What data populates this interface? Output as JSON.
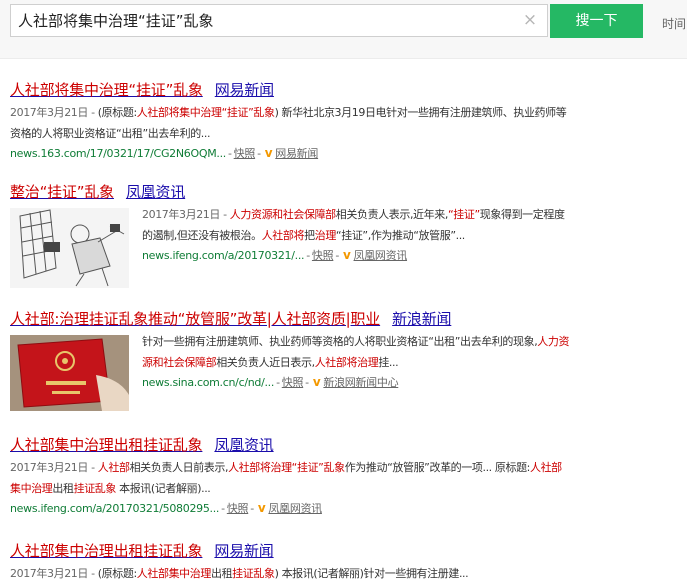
{
  "search": {
    "query": "人社部将集中治理“挂证”乱象",
    "clear_icon": "×",
    "button_label": "搜一下",
    "time_filter": "时间"
  },
  "results": [
    {
      "title": [
        "人社部将集中治理“挂证”乱象",
        "网易新闻"
      ],
      "snippet": {
        "date": "2017年3月21日 - ",
        "pre": "(原标题:",
        "hl": "人社部将集中治理“挂证”乱象",
        "post": ") 新华社北京3月19日电针对一些拥有注册建筑师、执业药师等资格的人将职业资格证“出租”出去牟利的..."
      },
      "url": "news.163.com/17/0321/17/CG2N6OQM...",
      "snapshot": "快照",
      "source": "网易新闻"
    },
    {
      "title": [
        "整治“挂证”乱象",
        "凤凰资讯"
      ],
      "snippet": {
        "date": "2017年3月21日 - ",
        "hl1": "人力资源和社会保障部",
        "mid1": "相关负责人表示,近年来,",
        "hl2": "“挂证”",
        "mid2": "现象得到一定程度的遏制,但还没有被根治。",
        "hl3": "人社部将",
        "mid3": "把",
        "hl4": "治理",
        "post": "“挂证”,作为推动“放管服”..."
      },
      "url": "news.ifeng.com/a/20170321/...",
      "snapshot": "快照",
      "source": "凤凰网资讯"
    },
    {
      "title": [
        "人社部:治理挂证乱象推动“放管服”改革|人社部资质|职业",
        "新浪新闻"
      ],
      "snippet": {
        "pre": "针对一些拥有注册建筑师、执业药师等资格的人将职业资格证“出租”出去牟利的现象,",
        "hl1": "人力资源和社会保障部",
        "mid1": "相关负责人近日表示,",
        "hl2": "人社部将治理",
        "post": "挂..."
      },
      "url": "news.sina.com.cn/c/nd/...",
      "snapshot": "快照",
      "source": "新浪网新闻中心"
    },
    {
      "title": [
        "人社部集中治理出租挂证乱象",
        "凤凰资讯"
      ],
      "snippet": {
        "date": "2017年3月21日 - ",
        "hl1": "人社部",
        "mid1": "相关负责人日前表示,",
        "hl2": "人社部将治理“挂证”乱象",
        "mid2": "作为推动“放管服”改革的一项... 原标题:",
        "hl3": "人社部集中治理",
        "mid3": "出租",
        "hl4": "挂证乱象",
        "post": " 本报讯(记者解丽)..."
      },
      "url": "news.ifeng.com/a/20170321/5080295...",
      "snapshot": "快照",
      "source": "凤凰网资讯"
    },
    {
      "title": [
        "人社部集中治理出租挂证乱象",
        "网易新闻"
      ],
      "snippet": {
        "date": "2017年3月21日 - ",
        "pre": "(原标题:",
        "hl1": "人社部集中治理",
        "mid1": "出租",
        "hl2": "挂证乱象",
        "post": ") 本报讯(记者解丽)针对一些拥有注册建..."
      }
    }
  ],
  "icons": {
    "clear": "close-icon",
    "source_v": "v-source-icon"
  },
  "colors": {
    "link": "#1a0dab",
    "highlight": "#cc0000",
    "url": "#0f7c36",
    "button": "#25b864"
  }
}
